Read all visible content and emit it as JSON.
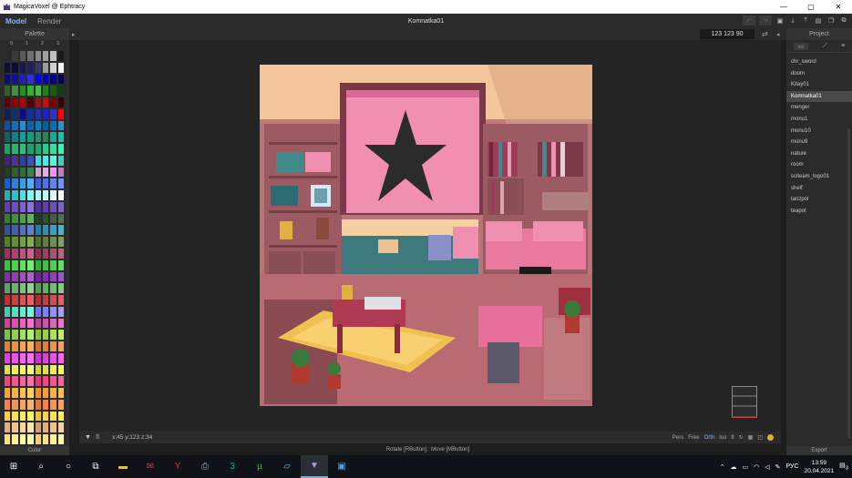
{
  "window": {
    "title": "MagicaVoxel @ Ephtracy",
    "minimize": "—",
    "maximize": "▢",
    "close": "✕"
  },
  "menu": {
    "tab_model": "Model",
    "tab_render": "Render",
    "file_name": "Komnatka01"
  },
  "palette": {
    "header": "Palette",
    "columns": [
      "0",
      "1",
      "2",
      "3"
    ],
    "footer": "Color",
    "colors": [
      "#2a2a2a",
      "#3a3a3a",
      "#5a5a5a",
      "#707070",
      "#8a8a8a",
      "#a0a0a0",
      "#c0c0c0",
      "#1a1a1a",
      "#101030",
      "#0a0a40",
      "#181850",
      "#202060",
      "#3a3a6a",
      "#9a9aa0",
      "#d0d0d0",
      "#f0f0f0",
      "#0a0a80",
      "#1010a0",
      "#2020c0",
      "#3030e0",
      "#0000ff",
      "#0000c0",
      "#000090",
      "#000060",
      "#306030",
      "#409040",
      "#209020",
      "#30b030",
      "#40c040",
      "#208020",
      "#106010",
      "#104010",
      "#600000",
      "#900000",
      "#b00000",
      "#500000",
      "#a01010",
      "#c01010",
      "#800000",
      "#400000",
      "#102050",
      "#103070",
      "#0a0a90",
      "#1030a0",
      "#2030b0",
      "#2020d0",
      "#3030d0",
      "#ff0000",
      "#1050a0",
      "#1070c0",
      "#2090d0",
      "#1060b0",
      "#0080c0",
      "#0060a0",
      "#0070b0",
      "#3090d0",
      "#106060",
      "#108080",
      "#10a0a0",
      "#10a080",
      "#209070",
      "#308060",
      "#10b090",
      "#20c0a0",
      "#20a060",
      "#30b070",
      "#30c080",
      "#20a070",
      "#10b070",
      "#20d090",
      "#30e0a0",
      "#40f0b0",
      "#402080",
      "#503090",
      "#3040a0",
      "#4050b0",
      "#30e0e0",
      "#40f0f0",
      "#50ffe0",
      "#40d0c0",
      "#204020",
      "#306030",
      "#307040",
      "#408050",
      "#d0a0d0",
      "#e0b0e0",
      "#ff90ff",
      "#c080c0",
      "#1060d0",
      "#3080e0",
      "#30a0f0",
      "#50b0ff",
      "#4060e0",
      "#5070f0",
      "#6080ff",
      "#7090ff",
      "#20b0b0",
      "#30c0c0",
      "#50e0e0",
      "#80ffff",
      "#a0ffff",
      "#c0ffff",
      "#e0ffff",
      "#ffffff",
      "#6040b0",
      "#7050c0",
      "#8060d0",
      "#9070e0",
      "#5030a0",
      "#6040b0",
      "#7050c0",
      "#8060d0",
      "#308030",
      "#409040",
      "#50a050",
      "#60b060",
      "#204020",
      "#305030",
      "#406040",
      "#507050",
      "#3050a0",
      "#4060b0",
      "#5070c0",
      "#6080d0",
      "#2080a0",
      "#3090b0",
      "#40a0c0",
      "#50b0d0",
      "#508020",
      "#609030",
      "#70a040",
      "#80b050",
      "#507030",
      "#608040",
      "#709050",
      "#80a060",
      "#a03060",
      "#b04070",
      "#c05080",
      "#d06090",
      "#903050",
      "#a04060",
      "#b05070",
      "#c06080",
      "#40c040",
      "#50d050",
      "#60e060",
      "#70f070",
      "#30b030",
      "#40c040",
      "#50d050",
      "#60e060",
      "#8030a0",
      "#9040b0",
      "#a050c0",
      "#b060d0",
      "#7020a0",
      "#8030b0",
      "#9040c0",
      "#a050d0",
      "#60a060",
      "#70b070",
      "#80c080",
      "#90d090",
      "#50a050",
      "#60b060",
      "#70c070",
      "#80d080",
      "#c03030",
      "#d04040",
      "#e05050",
      "#f06060",
      "#b03030",
      "#c04040",
      "#d05050",
      "#e06060",
      "#40d0b0",
      "#50e0c0",
      "#60f0d0",
      "#70ffe0",
      "#7070ff",
      "#8080ff",
      "#9090ff",
      "#a0a0ff",
      "#d040a0",
      "#e050b0",
      "#f060c0",
      "#ff70d0",
      "#c040a0",
      "#d050b0",
      "#e060c0",
      "#f070d0",
      "#80c040",
      "#90d050",
      "#a0e060",
      "#b0f070",
      "#90c030",
      "#a0d040",
      "#b0e050",
      "#c0f060",
      "#e08030",
      "#f09040",
      "#ffa050",
      "#ffb060",
      "#d07030",
      "#e08040",
      "#f09050",
      "#ffa060",
      "#e040e0",
      "#f050f0",
      "#ff60ff",
      "#ff70ff",
      "#d030d0",
      "#e040e0",
      "#f050f0",
      "#ff60ff",
      "#e0e040",
      "#f0f050",
      "#ffff60",
      "#ffff80",
      "#d0d030",
      "#e0e040",
      "#f0f050",
      "#ffff60",
      "#ff4080",
      "#ff5090",
      "#ff60a0",
      "#ff70b0",
      "#f03070",
      "#ff4080",
      "#ff5090",
      "#ff60a0",
      "#ffa030",
      "#ffb040",
      "#ffc050",
      "#ffd060",
      "#f09020",
      "#ffa030",
      "#ffb040",
      "#ffc050",
      "#ff8040",
      "#ff9050",
      "#ffa060",
      "#ffb070",
      "#f07030",
      "#ff8040",
      "#ff9050",
      "#ffa060",
      "#ffd040",
      "#ffe050",
      "#fff060",
      "#ffff70",
      "#f0c030",
      "#ffd040",
      "#ffe050",
      "#fff060",
      "#e0b080",
      "#f0c090",
      "#ffd0a0",
      "#ffe0b0",
      "#d0a070",
      "#e0b080",
      "#f0c090",
      "#ffd0a0",
      "#ffe080",
      "#fff090",
      "#ffffa0",
      "#ffffc0",
      "#f0d070",
      "#ffe080",
      "#fff090",
      "#ffffa0"
    ]
  },
  "viewport": {
    "coords": "123  123  90",
    "position_readout": "x:45   y:123  z:34"
  },
  "status": {
    "modes": [
      "Pers",
      "Free",
      "Orth",
      "Iso"
    ],
    "active_mode": "Orth",
    "count": "9",
    "hint": "Rotate [RButton] : Move [MButton]"
  },
  "project": {
    "header": "Project",
    "items": [
      "chr_sword",
      "doom",
      "Kitay01",
      "Komnatka01",
      "menger",
      "monu1",
      "monu10",
      "monu9",
      "nature",
      "room",
      "sciteam_logo01",
      "shelf",
      "tanzpol",
      "teapot"
    ],
    "selected": "Komnatka01",
    "footer": "Export"
  },
  "taskbar": {
    "lang": "РУС",
    "time": "13:59",
    "date": "20.04.2021",
    "notifications": "3"
  }
}
